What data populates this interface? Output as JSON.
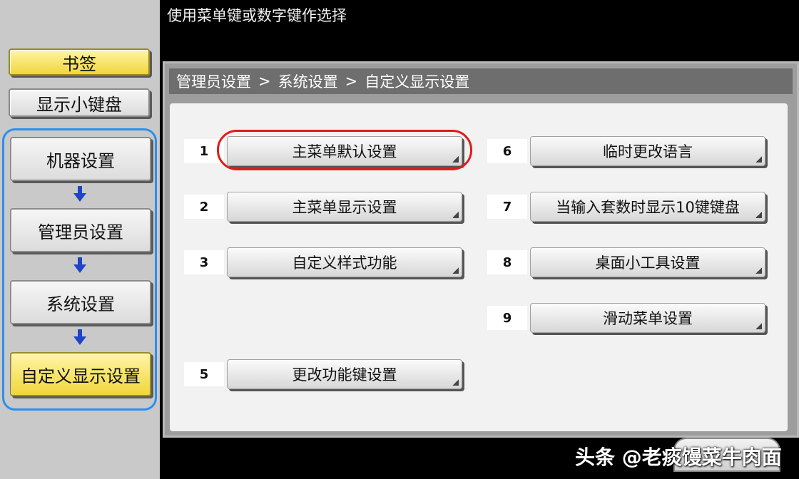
{
  "instruction": "使用菜单键或数字键作选择",
  "sidebar": {
    "bookmark_label": "书签",
    "keypad_label": "显示小键盘",
    "nav": [
      {
        "label": "机器设置"
      },
      {
        "label": "管理员设置"
      },
      {
        "label": "系统设置"
      },
      {
        "label": "自定义显示设置"
      }
    ]
  },
  "header": {
    "crumbs": [
      "管理员设置",
      "系统设置",
      "自定义显示设置"
    ],
    "separator": ">"
  },
  "options": [
    {
      "num": "1",
      "label": "主菜单默认设置"
    },
    {
      "num": "2",
      "label": "主菜单显示设置"
    },
    {
      "num": "3",
      "label": "自定义样式功能"
    },
    {
      "num": "5",
      "label": "更改功能键设置"
    },
    {
      "num": "6",
      "label": "临时更改语言"
    },
    {
      "num": "7",
      "label": "当输入套数时显示10键键盘"
    },
    {
      "num": "8",
      "label": "桌面小工具设置"
    },
    {
      "num": "9",
      "label": "滑动菜单设置"
    }
  ],
  "watermark": "头条 @老痰馒菜牛肉面",
  "colors": {
    "highlight_ring": "#e01b1b",
    "nav_outline": "#2b8ff0",
    "selected_yellow": "#f0d63a"
  }
}
